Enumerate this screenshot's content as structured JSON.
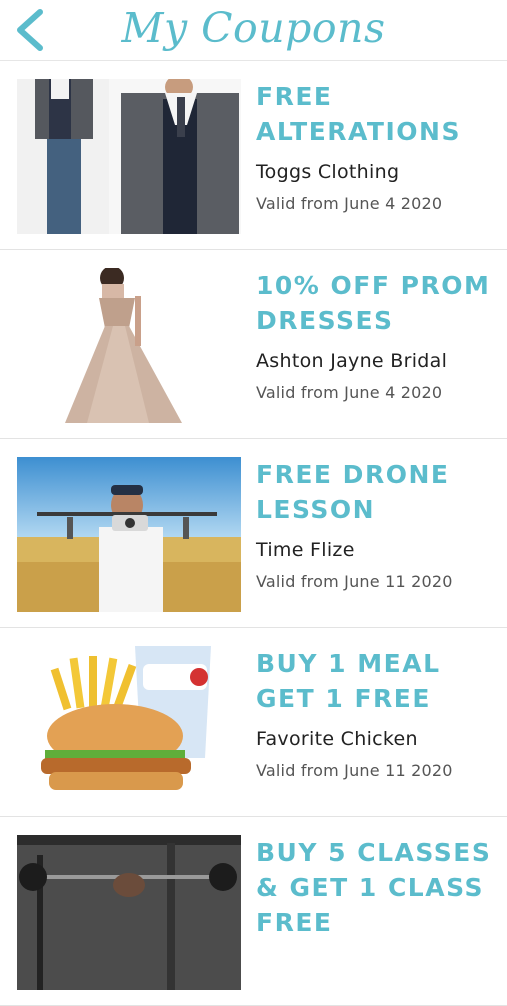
{
  "header": {
    "title": "My Coupons",
    "back_icon": "chevron-left-icon"
  },
  "colors": {
    "accent": "#5bbccc",
    "text": "#222222",
    "muted": "#555555",
    "divider": "#e3e3e3"
  },
  "coupons": [
    {
      "title": "FREE ALTERATIONS",
      "merchant": "Toggs Clothing",
      "valid": "Valid from June 4 2020",
      "image": "men-in-suits-photo"
    },
    {
      "title": "10% OFF PROM DRESSES",
      "merchant": "Ashton Jayne Bridal",
      "valid": "Valid from June 4 2020",
      "image": "prom-dress-photo"
    },
    {
      "title": "FREE DRONE LESSON",
      "merchant": "Time Flize",
      "valid": "Valid from June 11 2020",
      "image": "drone-pilot-photo"
    },
    {
      "title": "BUY 1 MEAL GET 1 FREE",
      "merchant": "Favorite Chicken",
      "valid": "Valid from June 11 2020",
      "image": "chicken-burger-meal-photo"
    },
    {
      "title": "BUY 5 CLASSES & GET 1 CLASS FREE",
      "merchant": "",
      "valid": "",
      "image": "gym-class-photo"
    }
  ]
}
